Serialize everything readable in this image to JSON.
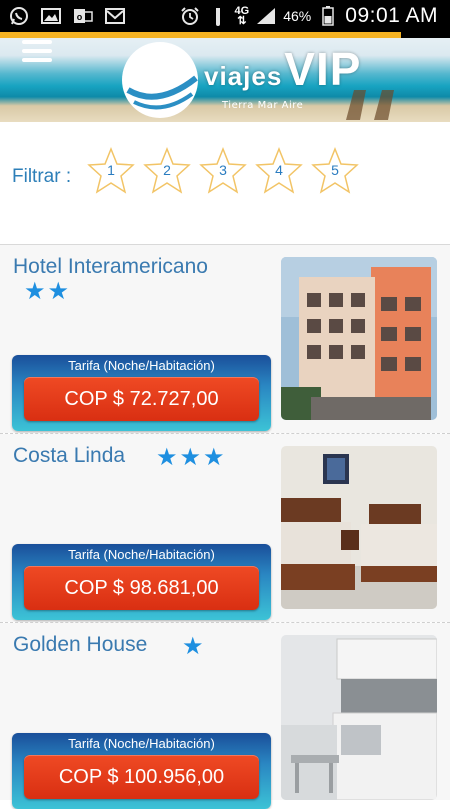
{
  "status_bar": {
    "icons": [
      "whatsapp-icon",
      "gallery-icon",
      "outlook-icon",
      "mail-icon",
      "alarm-icon",
      "mute-icon",
      "network-icon",
      "signal-icon",
      "battery-icon"
    ],
    "network": "4G",
    "battery": "46%",
    "time": "09:01 AM"
  },
  "header": {
    "menu_icon": "hamburger-icon",
    "logo_word1": "viajes",
    "logo_word2": "VIP",
    "tagline": "Tierra  Mar  Aire",
    "loading_progress": 0.89
  },
  "filter": {
    "label": "Filtrar :",
    "stars": [
      "1",
      "2",
      "3",
      "4",
      "5"
    ]
  },
  "hotels": [
    {
      "name": "Hotel Interamericano",
      "stars": "★★",
      "rating": 2,
      "rate_caption": "Tarifa (Noche/Habitación)",
      "price": "COP $ 72.727,00"
    },
    {
      "name": "Costa Linda",
      "stars": "★★★",
      "rating": 3,
      "rate_caption": "Tarifa (Noche/Habitación)",
      "price": "COP $ 98.681,00"
    },
    {
      "name": "Golden House",
      "stars": "★",
      "rating": 1,
      "rate_caption": "Tarifa (Noche/Habitación)",
      "price": "COP $ 100.956,00"
    }
  ],
  "colors": {
    "accent_blue": "#2d7fb8",
    "star_blue": "#1e8fe0",
    "price_red": "#e03a18",
    "progress": "#f5b324"
  }
}
